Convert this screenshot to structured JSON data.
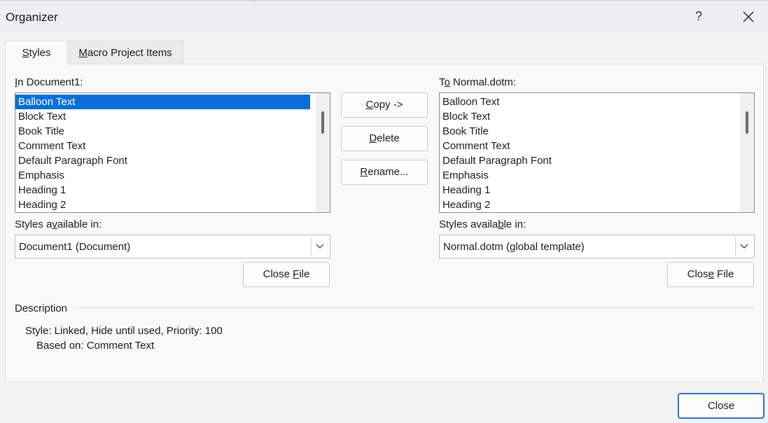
{
  "window": {
    "title": "Organizer",
    "help_label": "?",
    "close_icon": "close-icon"
  },
  "tabs": [
    {
      "label": "Styles",
      "accel": "S",
      "active": true
    },
    {
      "label": "Macro Project Items",
      "accel": "M",
      "active": false
    }
  ],
  "left": {
    "list_label_accel": "I",
    "list_label_rest": "n Document1:",
    "items": [
      "Balloon Text",
      "Block Text",
      "Book Title",
      "Comment Text",
      "Default Paragraph Font",
      "Emphasis",
      "Heading 1",
      "Heading 2"
    ],
    "selected_index": 0,
    "available_label_pre": "Styles a",
    "available_label_accel": "v",
    "available_label_post": "ailable in:",
    "select_value": "Document1 (Document)",
    "close_file_pre": "Close ",
    "close_file_accel": "F",
    "close_file_post": "ile"
  },
  "right": {
    "list_label_pre": "T",
    "list_label_accel": "o",
    "list_label_post": " Normal.dotm:",
    "items": [
      "Balloon Text",
      "Block Text",
      "Book Title",
      "Comment Text",
      "Default Paragraph Font",
      "Emphasis",
      "Heading 1",
      "Heading 2"
    ],
    "available_label_pre": "Styles availa",
    "available_label_accel": "b",
    "available_label_post": "le in:",
    "select_value": "Normal.dotm (global template)",
    "close_file_pre": "Clos",
    "close_file_accel": "e",
    "close_file_post": " File"
  },
  "actions": {
    "copy_accel": "C",
    "copy_rest": "opy ->",
    "delete_accel": "D",
    "delete_rest": "elete",
    "rename_accel": "R",
    "rename_rest": "ename..."
  },
  "description": {
    "heading": "Description",
    "line1": "Style: Linked, Hide until used, Priority: 100",
    "line2": "Based on: Comment Text"
  },
  "footer": {
    "close_label": "Close"
  },
  "colors": {
    "selection": "#0a6fd6",
    "default_button_border": "#2f6fba"
  }
}
